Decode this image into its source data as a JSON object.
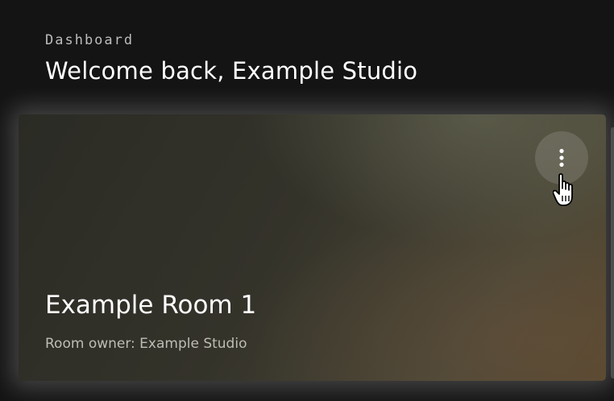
{
  "header": {
    "kicker": "Dashboard",
    "title": "Welcome back, Example Studio"
  },
  "room_card": {
    "name": "Example Room 1",
    "owner_line": "Room owner: Example Studio",
    "menu_icon": "more-vertical-icon"
  },
  "cursor": {
    "type": "hand-pointer-icon"
  }
}
